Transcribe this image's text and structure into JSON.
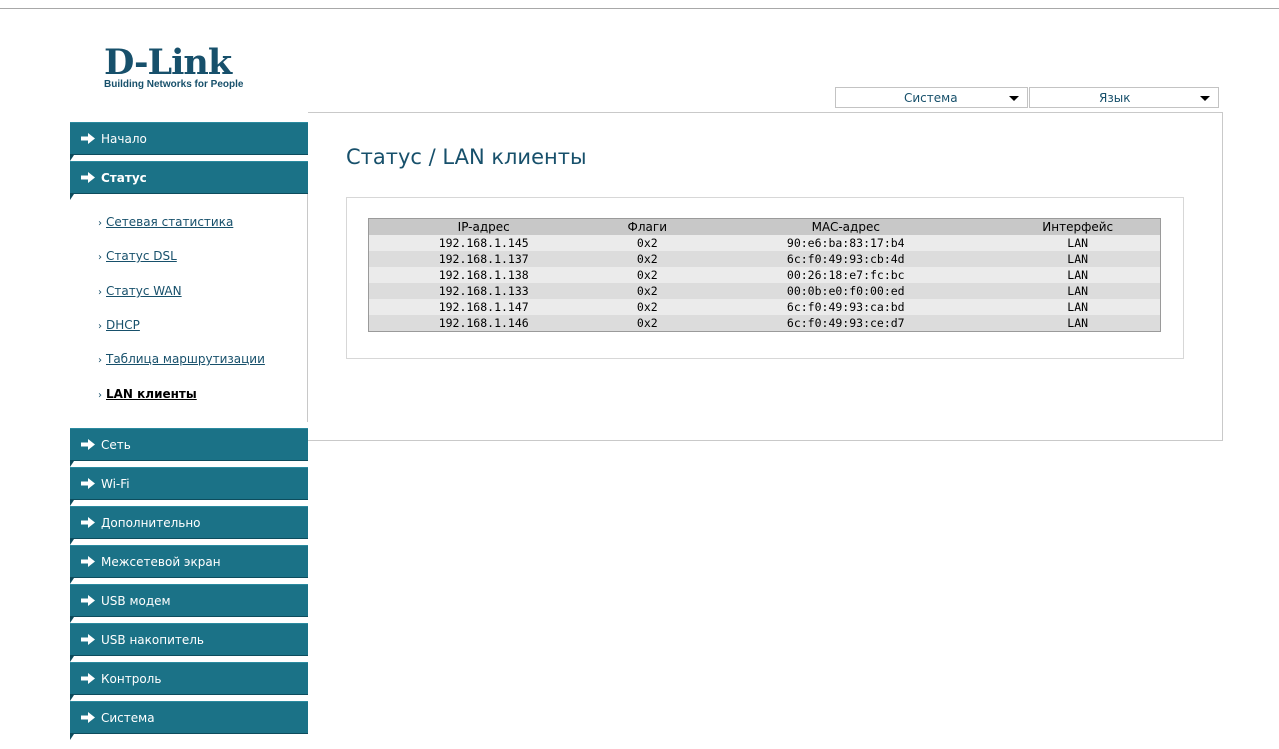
{
  "brand": {
    "name": "D-Link",
    "tagline": "Building Networks for People"
  },
  "top_menus": {
    "system": "Система",
    "language": "Язык"
  },
  "sidebar": {
    "items": [
      {
        "label": "Начало",
        "icon": "arrow-right-icon"
      },
      {
        "label": "Статус",
        "icon": "arrow-right-icon",
        "active": true
      },
      {
        "label": "Сеть",
        "icon": "arrow-right-icon"
      },
      {
        "label": "Wi-Fi",
        "icon": "arrow-right-icon"
      },
      {
        "label": "Дополнительно",
        "icon": "arrow-right-icon"
      },
      {
        "label": "Межсетевой экран",
        "icon": "arrow-right-icon"
      },
      {
        "label": "USB модем",
        "icon": "arrow-right-icon"
      },
      {
        "label": "USB накопитель",
        "icon": "arrow-right-icon"
      },
      {
        "label": "Контроль",
        "icon": "arrow-right-icon"
      },
      {
        "label": "Система",
        "icon": "arrow-right-icon"
      }
    ],
    "status_submenu": [
      {
        "label": "Сетевая статистика"
      },
      {
        "label": "Статус DSL"
      },
      {
        "label": "Статус WAN"
      },
      {
        "label": "DHCP"
      },
      {
        "label": "Таблица маршрутизации"
      },
      {
        "label": "LAN клиенты",
        "current": true
      }
    ]
  },
  "main": {
    "title": "Статус / LAN клиенты",
    "table": {
      "headers": [
        "IP-адрес",
        "Флаги",
        "MAC-адрес",
        "Интерфейс"
      ],
      "rows": [
        [
          "192.168.1.145",
          "0x2",
          "90:e6:ba:83:17:b4",
          "LAN"
        ],
        [
          "192.168.1.137",
          "0x2",
          "6c:f0:49:93:cb:4d",
          "LAN"
        ],
        [
          "192.168.1.138",
          "0x2",
          "00:26:18:e7:fc:bc",
          "LAN"
        ],
        [
          "192.168.1.133",
          "0x2",
          "00:0b:e0:f0:00:ed",
          "LAN"
        ],
        [
          "192.168.1.147",
          "0x2",
          "6c:f0:49:93:ca:bd",
          "LAN"
        ],
        [
          "192.168.1.146",
          "0x2",
          "6c:f0:49:93:ce:d7",
          "LAN"
        ]
      ]
    }
  },
  "colors": {
    "accent": "#1b7287",
    "title": "#17506b"
  }
}
